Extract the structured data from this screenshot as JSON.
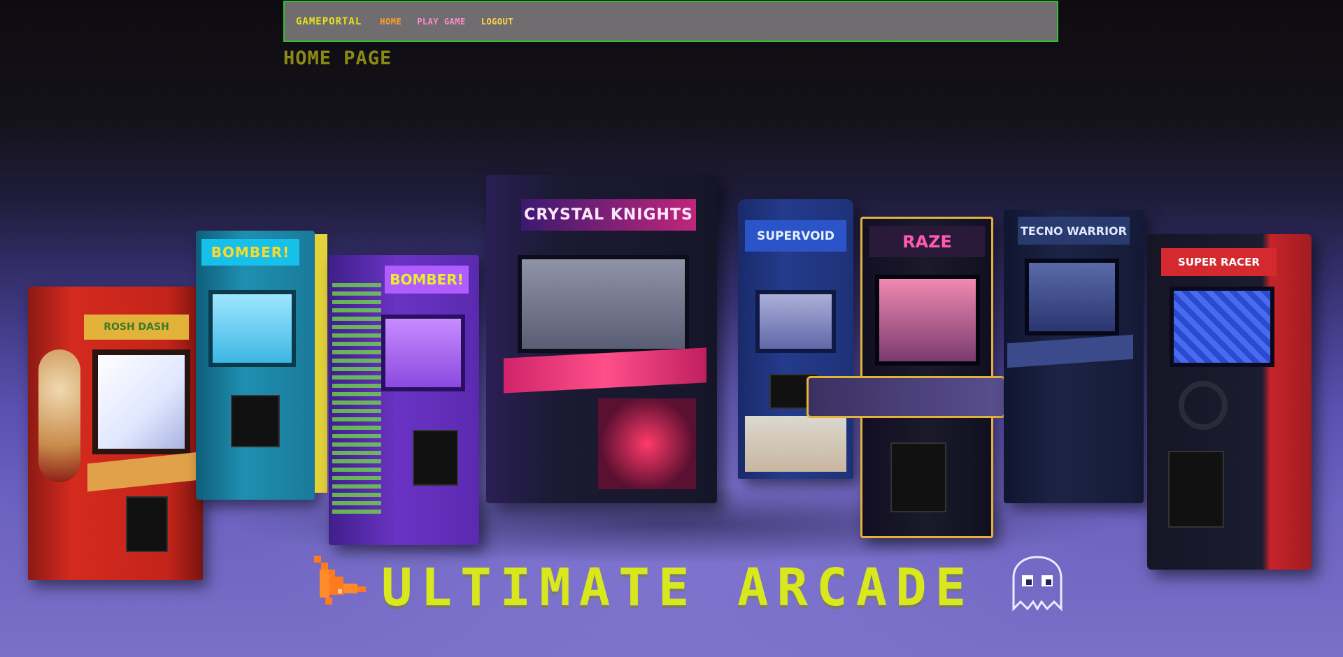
{
  "nav": {
    "brand": "GAMEPORTAL",
    "links": [
      {
        "label": "HOME",
        "color": "#ff9f2a"
      },
      {
        "label": "PLAY GAME",
        "color": "#ff8ac8"
      },
      {
        "label": "LOGOUT",
        "color": "#ffd24a"
      }
    ],
    "border_color": "#2fc12f",
    "background": "#6f6d6f"
  },
  "page": {
    "title": "HOME PAGE",
    "title_color": "#8a8a14"
  },
  "hero": {
    "title": "ULTIMATE ARCADE",
    "title_color": "#d8e81c",
    "left_icon": "pixel-arrow-icon",
    "right_icon": "ghost-icon"
  },
  "cabinets": [
    {
      "marquee": "ROSH DASH",
      "color": "#d42a1f"
    },
    {
      "marquee": "BOMBER!",
      "color": "#1f8fb0"
    },
    {
      "marquee": "BOMBER!",
      "color": "#6a33c4"
    },
    {
      "marquee": "CRYSTAL KNIGHTS",
      "color": "#1b1a33"
    },
    {
      "marquee": "SUPERVOID",
      "color": "#243b8c"
    },
    {
      "marquee": "RAZE",
      "color": "#1a1a2a"
    },
    {
      "marquee": "TECNO WARRIOR",
      "color": "#1c2446"
    },
    {
      "marquee": "SUPER RACER",
      "color": "#c6232a"
    }
  ]
}
